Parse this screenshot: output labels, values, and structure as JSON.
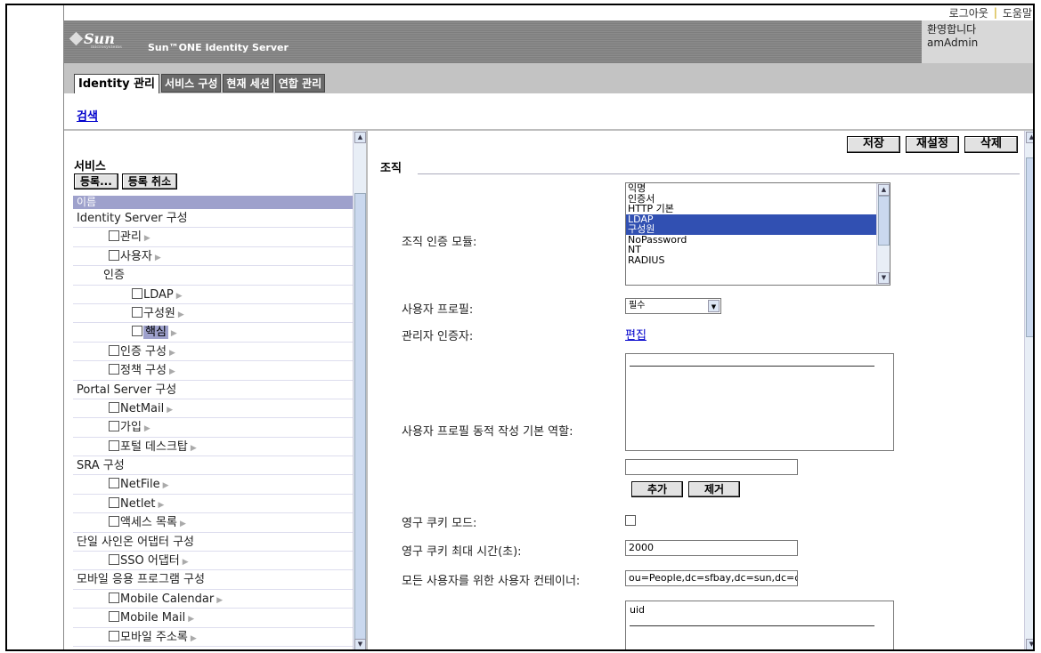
{
  "top_links": {
    "logout": "로그아웃",
    "help": "도움말"
  },
  "masthead": {
    "logo_text": "Sun",
    "logo_sub": "microsystems",
    "product_name": "Sun™ONE Identity Server",
    "welcome": "환영합니다",
    "user": "amAdmin"
  },
  "tabs": [
    {
      "label": "Identity 관리",
      "active": true
    },
    {
      "label": "서비스 구성",
      "active": false
    },
    {
      "label": "현재 세션",
      "active": false
    },
    {
      "label": "연합 관리",
      "active": false
    }
  ],
  "search_link": "검색",
  "left": {
    "title": "서비스",
    "register_button": "등록...",
    "unregister_button": "등록 취소",
    "column_header": "이름",
    "items": [
      {
        "label": "Identity Server 구성",
        "level": 0
      },
      {
        "label": "관리",
        "level": 1,
        "checkbox": true
      },
      {
        "label": "사용자",
        "level": 1,
        "checkbox": true
      },
      {
        "label": "인증",
        "level": 1
      },
      {
        "label": "LDAP",
        "level": 2,
        "checkbox": true
      },
      {
        "label": "구성원",
        "level": 2,
        "checkbox": true
      },
      {
        "label": "핵심",
        "level": 2,
        "checkbox": true,
        "highlight": true
      },
      {
        "label": "인증 구성",
        "level": 1,
        "checkbox": true
      },
      {
        "label": "정책 구성",
        "level": 1,
        "checkbox": true
      },
      {
        "label": "Portal Server 구성",
        "level": 0
      },
      {
        "label": "NetMail",
        "level": 1,
        "checkbox": true
      },
      {
        "label": "가입",
        "level": 1,
        "checkbox": true
      },
      {
        "label": "포털 데스크탑",
        "level": 1,
        "checkbox": true
      },
      {
        "label": "SRA 구성",
        "level": 0
      },
      {
        "label": "NetFile",
        "level": 1,
        "checkbox": true
      },
      {
        "label": "Netlet",
        "level": 1,
        "checkbox": true
      },
      {
        "label": "액세스 목록",
        "level": 1,
        "checkbox": true
      },
      {
        "label": "단일 사인온 어댑터 구성",
        "level": 0
      },
      {
        "label": "SSO 어댑터",
        "level": 1,
        "checkbox": true
      },
      {
        "label": "모바일 응용 프로그램 구성",
        "level": 0
      },
      {
        "label": "Mobile Calendar",
        "level": 1,
        "checkbox": true
      },
      {
        "label": "Mobile Mail",
        "level": 1,
        "checkbox": true
      },
      {
        "label": "모바일 주소록",
        "level": 1,
        "checkbox": true
      }
    ]
  },
  "right": {
    "save_button": "저장",
    "reset_button": "재설정",
    "delete_button": "삭제",
    "section_title": "조직",
    "auth_module_label": "조직 인증 모듈:",
    "auth_modules": [
      {
        "label": "익명",
        "selected": false
      },
      {
        "label": "인증서",
        "selected": false
      },
      {
        "label": "HTTP 기본",
        "selected": false
      },
      {
        "label": "LDAP",
        "selected": true
      },
      {
        "label": "구성원",
        "selected": true
      },
      {
        "label": "NoPassword",
        "selected": false
      },
      {
        "label": "NT",
        "selected": false
      },
      {
        "label": "RADIUS",
        "selected": false
      }
    ],
    "user_profile_label": "사용자 프로필:",
    "user_profile_value": "필수",
    "admin_auth_label": "관리자 인증자:",
    "admin_auth_link": "편집",
    "dynamic_role_label": "사용자 프로필 동적 작성 기본 역할:",
    "add_button": "추가",
    "remove_button": "제거",
    "persistent_cookie_label": "영구 쿠키 모드:",
    "cookie_max_time_label": "영구 쿠키 최대 시간(초):",
    "cookie_max_time_value": "2000",
    "user_container_label": "모든 사용자를 위한 사용자 컨테이너:",
    "user_container_value": "ou=People,dc=sfbay,dc=sun,dc=c",
    "naming_attr_value": "uid"
  }
}
